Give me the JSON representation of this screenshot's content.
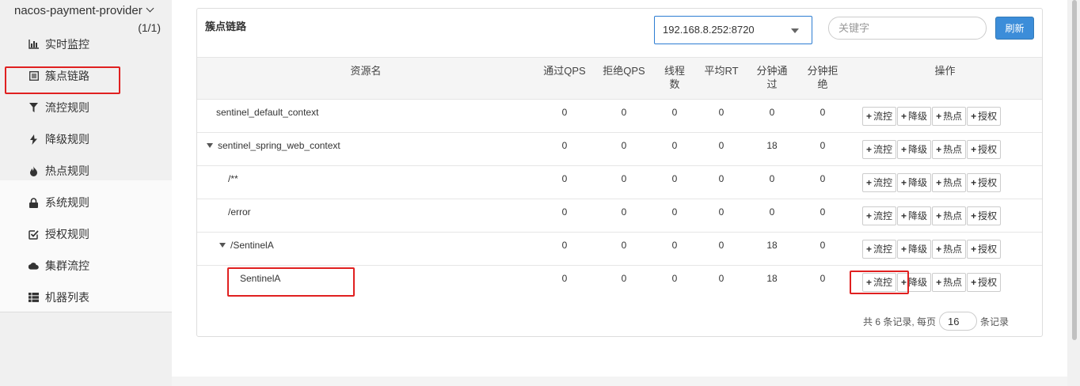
{
  "sidebar": {
    "app_name": "nacos-payment-provider",
    "app_count": "(1/1)",
    "items": [
      {
        "label": "实时监控",
        "icon": "bar-chart-icon"
      },
      {
        "label": "簇点链路",
        "icon": "list-icon"
      },
      {
        "label": "流控规则",
        "icon": "filter-icon"
      },
      {
        "label": "降级规则",
        "icon": "flash-icon"
      },
      {
        "label": "热点规则",
        "icon": "fire-icon"
      },
      {
        "label": "系统规则",
        "icon": "lock-icon"
      },
      {
        "label": "授权规则",
        "icon": "check-square-icon"
      },
      {
        "label": "集群流控",
        "icon": "cloud-icon"
      },
      {
        "label": "机器列表",
        "icon": "th-list-icon"
      }
    ]
  },
  "panel": {
    "title": "簇点链路",
    "machine": "192.168.8.252:8720",
    "search_placeholder": "关键字",
    "refresh_label": "刷新"
  },
  "table": {
    "headers": {
      "resource": "资源名",
      "pass_qps": "通过QPS",
      "block_qps": "拒绝QPS",
      "threads": "线程\n数",
      "avg_rt": "平均RT",
      "minute_pass": "分钟通\n过",
      "minute_block": "分钟拒\n绝",
      "ops": "操作"
    },
    "rows": [
      {
        "name": "sentinel_default_context",
        "pass_qps": "0",
        "block_qps": "0",
        "threads": "0",
        "avg_rt": "0",
        "minute_pass": "0",
        "minute_block": "0"
      },
      {
        "name": "sentinel_spring_web_context",
        "pass_qps": "0",
        "block_qps": "0",
        "threads": "0",
        "avg_rt": "0",
        "minute_pass": "18",
        "minute_block": "0"
      },
      {
        "name": "/**",
        "pass_qps": "0",
        "block_qps": "0",
        "threads": "0",
        "avg_rt": "0",
        "minute_pass": "0",
        "minute_block": "0"
      },
      {
        "name": "/error",
        "pass_qps": "0",
        "block_qps": "0",
        "threads": "0",
        "avg_rt": "0",
        "minute_pass": "0",
        "minute_block": "0"
      },
      {
        "name": "/SentinelA",
        "pass_qps": "0",
        "block_qps": "0",
        "threads": "0",
        "avg_rt": "0",
        "minute_pass": "18",
        "minute_block": "0"
      },
      {
        "name": "SentinelA",
        "pass_qps": "0",
        "block_qps": "0",
        "threads": "0",
        "avg_rt": "0",
        "minute_pass": "18",
        "minute_block": "0"
      }
    ],
    "op_buttons": {
      "flow": "流控",
      "degrade": "降级",
      "hotspot": "热点",
      "authority": "授权"
    }
  },
  "pager": {
    "prefix": "共 6 条记录, 每页",
    "page_size": "16",
    "suffix": "条记录"
  },
  "colors": {
    "accent": "#3c8dd9",
    "highlight": "#e02020"
  }
}
